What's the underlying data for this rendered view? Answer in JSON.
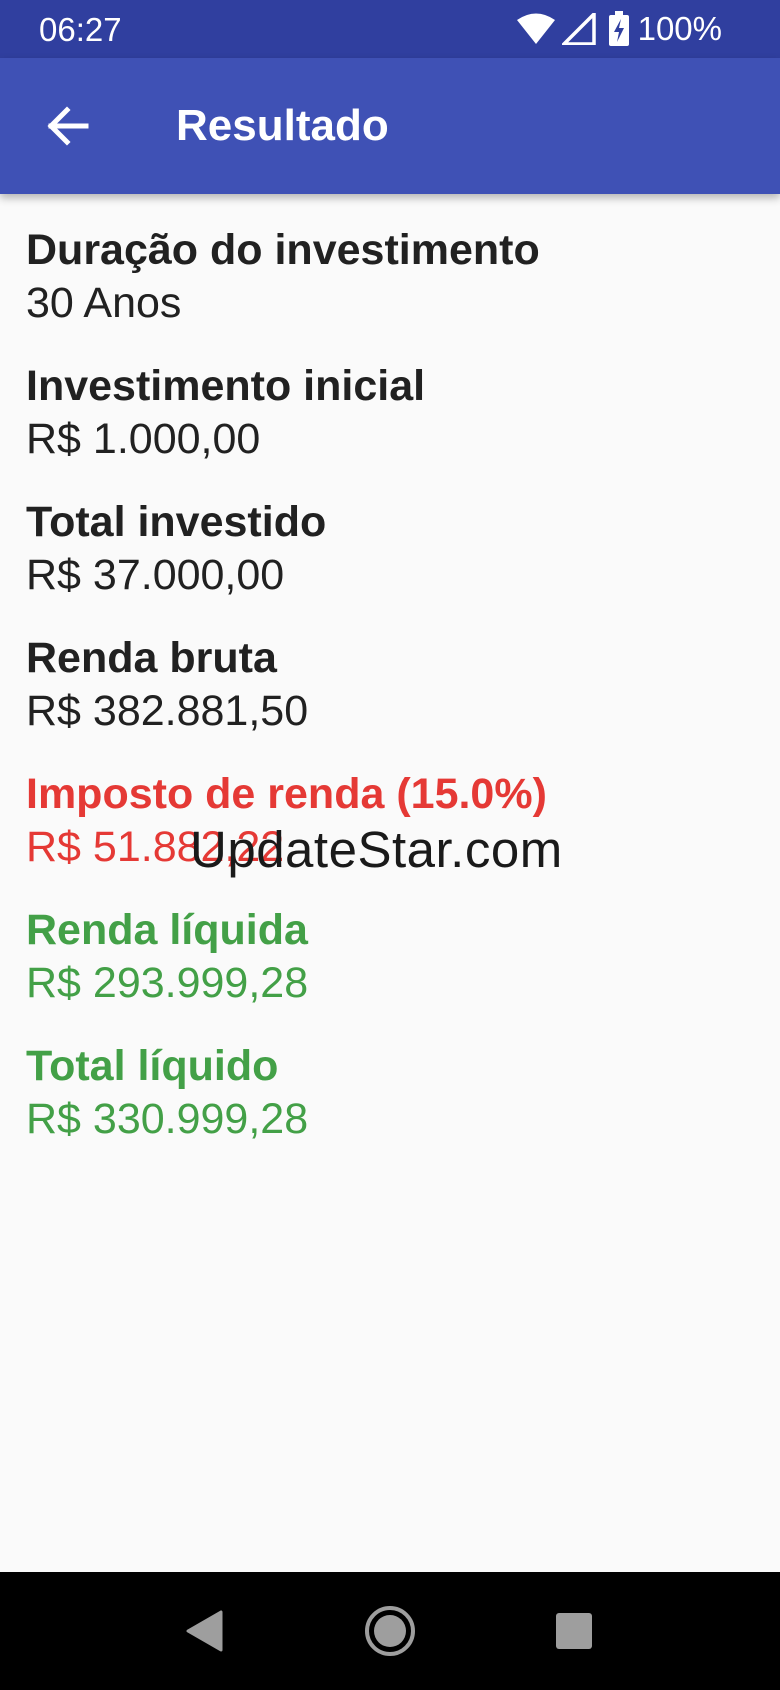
{
  "status_bar": {
    "time": "06:27",
    "icons": [
      "wifi-icon",
      "signal-icon",
      "battery-charging-icon"
    ],
    "battery": "100%"
  },
  "app_bar": {
    "back_icon": "arrow-back-icon",
    "title": "Resultado"
  },
  "results": [
    {
      "label": "Duração do investimento",
      "value": "30 Anos",
      "style": "normal"
    },
    {
      "label": "Investimento inicial",
      "value": "R$ 1.000,00",
      "style": "normal"
    },
    {
      "label": "Total investido",
      "value": "R$ 37.000,00",
      "style": "normal"
    },
    {
      "label": "Renda bruta",
      "value": "R$ 382.881,50",
      "style": "normal"
    },
    {
      "label": "Imposto de renda (15.0%)",
      "value": "R$ 51.882,22",
      "style": "tax"
    },
    {
      "label": "Renda líquida",
      "value": "R$ 293.999,28",
      "style": "net"
    },
    {
      "label": "Total líquido",
      "value": "R$ 330.999,28",
      "style": "net"
    }
  ],
  "watermark": "UpdateStar.com",
  "nav_bar": {
    "icons": [
      "back-triangle-icon",
      "home-circle-icon",
      "recents-square-icon"
    ]
  },
  "colors": {
    "status_bar": "#303f9f",
    "app_bar": "#3f51b5",
    "background": "#fafafa",
    "text_primary": "#212121",
    "tax_red": "#e53935",
    "net_green": "#43a047"
  }
}
